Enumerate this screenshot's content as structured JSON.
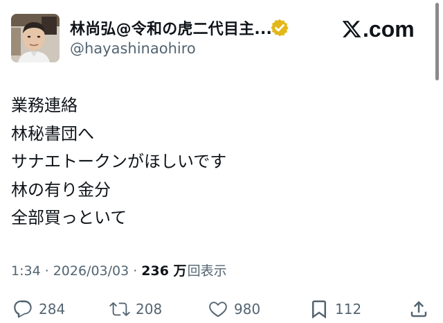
{
  "author": {
    "display_name": "林尚弘@令和の虎二代目主...",
    "handle": "@hayashinaohiro",
    "verified_badge_icon": "verified-badge-icon",
    "verified_color": "#e2b719"
  },
  "brand": {
    "label": ".com",
    "icon": "x-logo-icon"
  },
  "post": {
    "lines": [
      "業務連絡",
      "林秘書団へ",
      "サナエトークンがほしいです",
      "林の有り金分",
      "全部買っといて"
    ]
  },
  "meta": {
    "time": "1:34",
    "separator": "·",
    "date": "2026/03/03",
    "views_count": "236 万",
    "views_label": "回表示"
  },
  "actions": {
    "reply": {
      "icon": "reply-icon",
      "count": "284"
    },
    "repost": {
      "icon": "repost-icon",
      "count": "208"
    },
    "like": {
      "icon": "heart-icon",
      "count": "980"
    },
    "bookmark": {
      "icon": "bookmark-icon",
      "count": "112"
    },
    "share": {
      "icon": "share-icon"
    }
  },
  "colors": {
    "text_primary": "#0f1419",
    "text_secondary": "#536471"
  }
}
